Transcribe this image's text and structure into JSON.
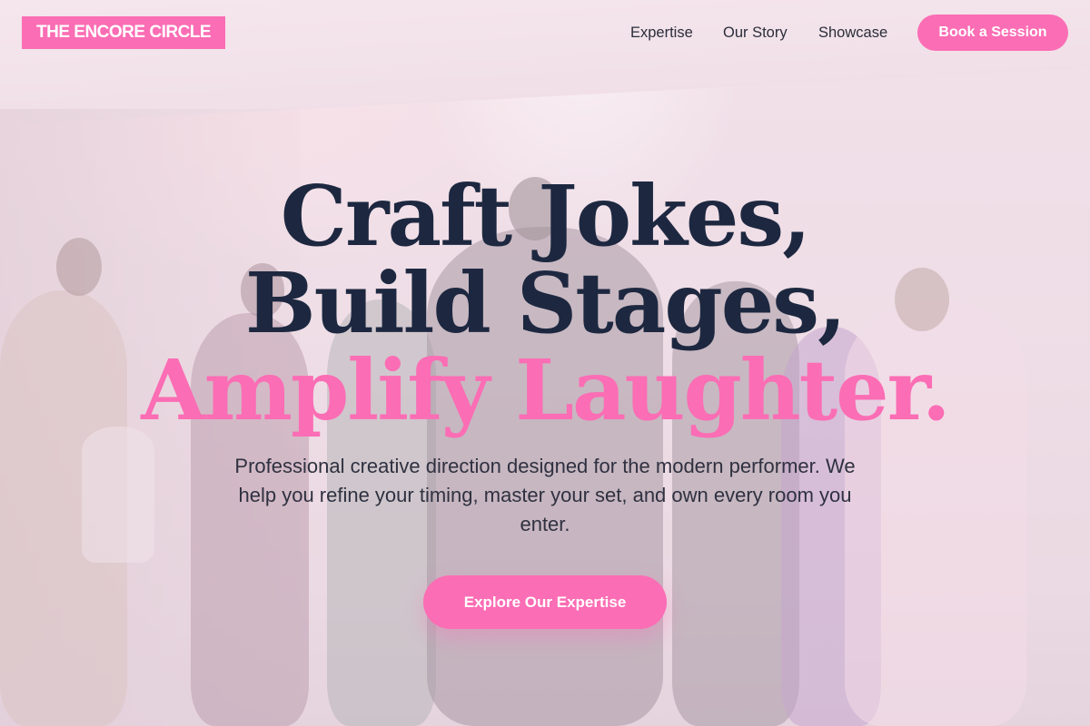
{
  "brand": {
    "logo_text": "THE ENCORE CIRCLE"
  },
  "nav": {
    "links": [
      {
        "label": "Expertise"
      },
      {
        "label": "Our Story"
      },
      {
        "label": "Showcase"
      }
    ],
    "cta_label": "Book a Session"
  },
  "hero": {
    "headline_line1": "Craft Jokes,",
    "headline_line2": "Build Stages,",
    "headline_line3": "Amplify Laughter.",
    "subtitle": "Professional creative direction designed for the modern performer. We help you refine your timing, master your set, and own every room you enter.",
    "cta_label": "Explore Our Expertise",
    "background_image": "group of performers on a stage"
  },
  "colors": {
    "accent": "#fb6db4",
    "heading": "#1d2840",
    "body_text": "#2f3140"
  }
}
